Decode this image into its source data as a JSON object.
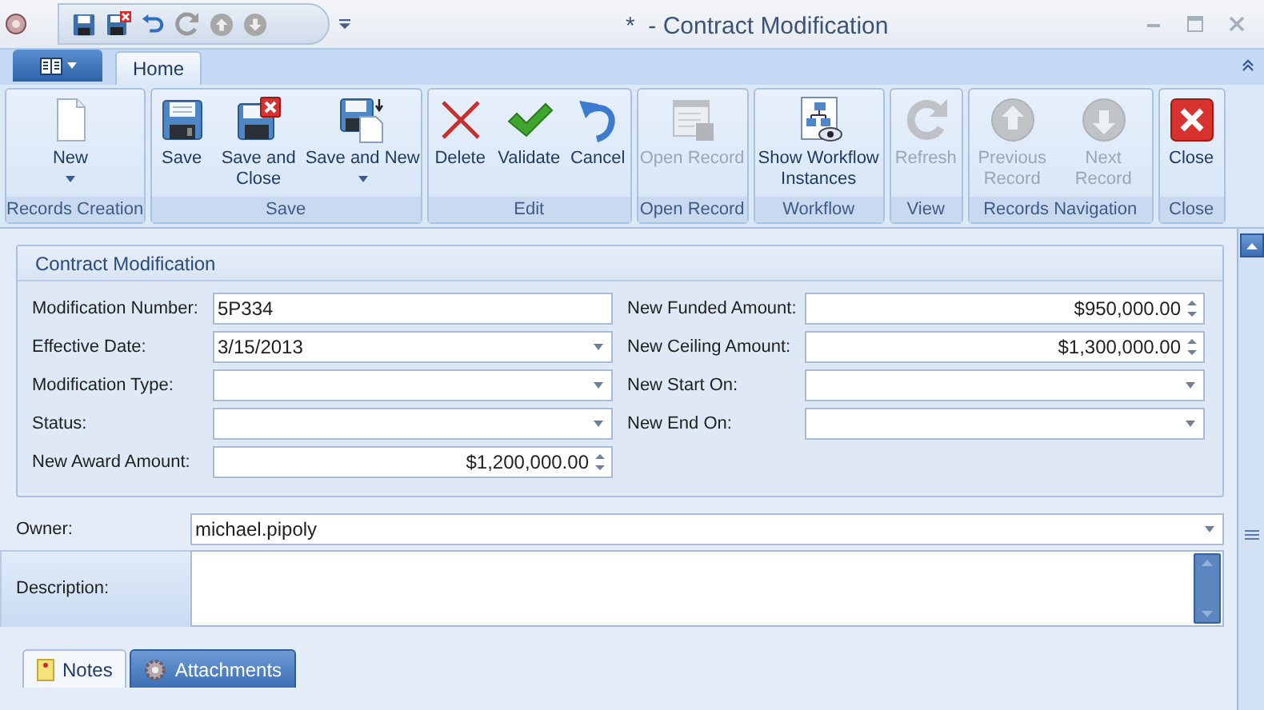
{
  "window": {
    "title": "*  - Contract Modification"
  },
  "ribbon_tabs": [
    {
      "label": "Home",
      "selected": true
    }
  ],
  "ribbon_groups": [
    {
      "label": "Records Creation",
      "buttons": [
        {
          "label": "New",
          "disabled": false,
          "dropdown": true
        }
      ]
    },
    {
      "label": "Save",
      "buttons": [
        {
          "label": "Save",
          "disabled": false,
          "dropdown": false
        },
        {
          "label": "Save and Close",
          "disabled": false,
          "dropdown": false
        },
        {
          "label": "Save and New",
          "disabled": false,
          "dropdown": true
        }
      ]
    },
    {
      "label": "Edit",
      "buttons": [
        {
          "label": "Delete",
          "disabled": false,
          "dropdown": false
        },
        {
          "label": "Validate",
          "disabled": false,
          "dropdown": false
        },
        {
          "label": "Cancel",
          "disabled": false,
          "dropdown": false
        }
      ]
    },
    {
      "label": "Open Record",
      "buttons": [
        {
          "label": "Open Record",
          "disabled": true,
          "dropdown": false
        }
      ]
    },
    {
      "label": "Workflow",
      "buttons": [
        {
          "label": "Show Workflow Instances",
          "disabled": false,
          "dropdown": false
        }
      ]
    },
    {
      "label": "View",
      "buttons": [
        {
          "label": "Refresh",
          "disabled": true,
          "dropdown": false
        }
      ]
    },
    {
      "label": "Records Navigation",
      "buttons": [
        {
          "label": "Previous Record",
          "disabled": true,
          "dropdown": false
        },
        {
          "label": "Next Record",
          "disabled": true,
          "dropdown": false
        }
      ]
    },
    {
      "label": "Close",
      "buttons": [
        {
          "label": "Close",
          "disabled": false,
          "dropdown": false
        }
      ]
    }
  ],
  "form": {
    "title": "Contract Modification",
    "left_fields": [
      {
        "label": "Modification Number:",
        "kind": "text",
        "value": "5P334"
      },
      {
        "label": "Effective Date:",
        "kind": "dropdown",
        "value": "3/15/2013"
      },
      {
        "label": "Modification Type:",
        "kind": "dropdown"
      },
      {
        "label": "Status:",
        "kind": "dropdown"
      },
      {
        "label": "New Award Amount:",
        "kind": "spin",
        "value": "$1,200,000.00"
      }
    ],
    "right_fields": [
      {
        "label": "New Funded Amount:",
        "kind": "spin",
        "value": "$950,000.00"
      },
      {
        "label": "New Ceiling Amount:",
        "kind": "spin",
        "value": "$1,300,000.00"
      },
      {
        "label": "New Start On:",
        "kind": "dropdown"
      },
      {
        "label": "New End On:",
        "kind": "dropdown"
      }
    ]
  },
  "owner": {
    "label": "Owner:",
    "kind": "dropdown",
    "value": "michael.pipoly"
  },
  "description": {
    "label": "Description:"
  },
  "bottom_tabs": [
    {
      "label": "Notes",
      "selected": true
    },
    {
      "label": "Attachments",
      "selected": false
    }
  ]
}
